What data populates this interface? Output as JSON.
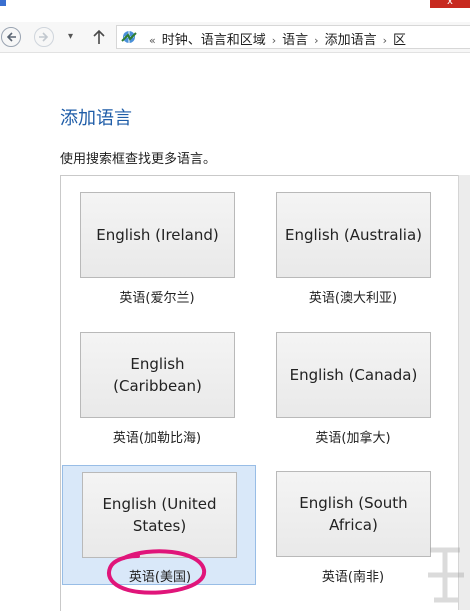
{
  "window": {
    "close_glyph": "x"
  },
  "nav": {
    "dropdown_glyph": "▾",
    "breadcrumb": [
      "时钟、语言和区域",
      "语言",
      "添加语言",
      "区"
    ],
    "overflow_glyph": "«",
    "separator_glyph": "›"
  },
  "page": {
    "title": "添加语言",
    "subtitle": "使用搜索框查找更多语言。"
  },
  "languages": [
    {
      "tile": "English (Ireland)",
      "label": "英语(爱尔兰)"
    },
    {
      "tile": "English (Australia)",
      "label": "英语(澳大利亚)"
    },
    {
      "tile": "English (Caribbean)",
      "label": "英语(加勒比海)"
    },
    {
      "tile": "English (Canada)",
      "label": "英语(加拿大)"
    },
    {
      "tile": "English (United States)",
      "label": "英语(美国)",
      "selected": true
    },
    {
      "tile": "English (South Africa)",
      "label": "英语(南非)"
    }
  ],
  "colors": {
    "title": "#1f5da8",
    "selection_bg": "#d9e8f9",
    "annotation": "#e0157a"
  }
}
